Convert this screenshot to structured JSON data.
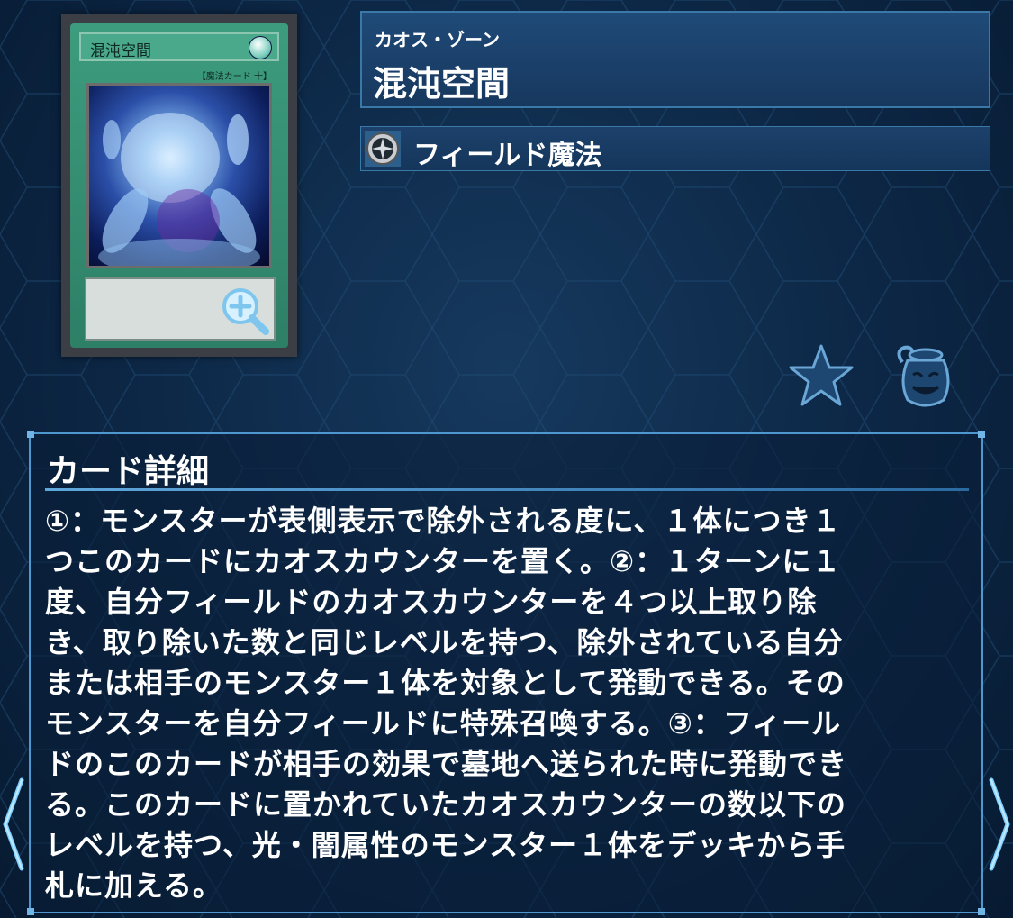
{
  "card": {
    "name_on_card": "混沌空間",
    "type_on_card": "【魔法カード 十】"
  },
  "header": {
    "ruby": "カオス・ゾーン",
    "title": "混沌空間"
  },
  "type_row": {
    "icon": "spell-icon",
    "label": "フィールド魔法"
  },
  "actions": {
    "favorite_icon": "star-icon",
    "pot_icon": "pot-of-greed-icon"
  },
  "details": {
    "heading": "カード詳細",
    "text": "①：モンスターが表側表示で除外される度に、１体につき１\nつこのカードにカオスカウンターを置く。②：１ターンに１\n度、自分フィールドのカオスカウンターを４つ以上取り除\nき、取り除いた数と同じレベルを持つ、除外されている自分\nまたは相手のモンスター１体を対象として発動できる。その\nモンスターを自分フィールドに特殊召喚する。③：フィール\nドのこのカードが相手の効果で墓地へ送られた時に発動でき\nる。このカードに置かれていたカオスカウンターの数以下の\nレベルを持つ、光・闇属性のモンスター１体をデッキから手\n札に加える。"
  },
  "navigation": {
    "prev_icon": "chevron-left-icon",
    "next_icon": "chevron-right-icon"
  },
  "colors": {
    "background": "#0b2440",
    "panel_border": "#3a78a8",
    "accent": "#4f98cf",
    "card_green": "#3d9c7e"
  }
}
